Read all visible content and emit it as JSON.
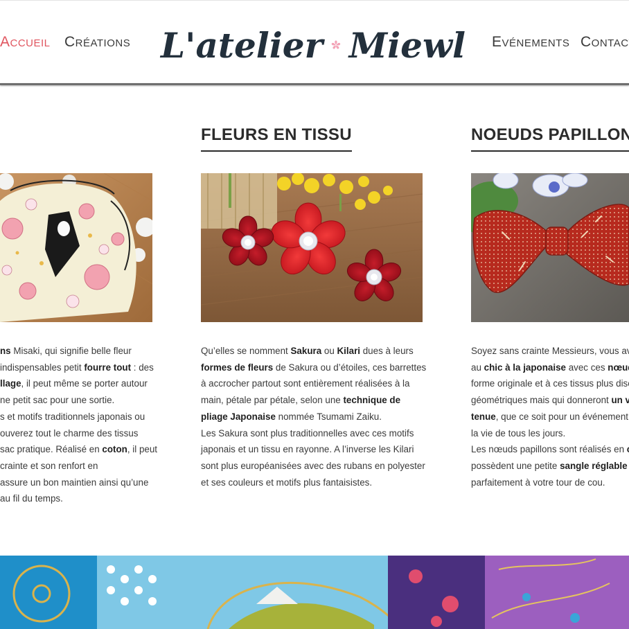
{
  "nav": {
    "left": [
      "Accueil",
      "Créations"
    ],
    "right": [
      "Evénements",
      "Contact"
    ],
    "active": "Accueil"
  },
  "logo": {
    "part1": "L'atelier",
    "part2": "Miewl",
    "flower_icon": "sakura-icon",
    "color": "#23303c",
    "flower_color": "#f08aa3"
  },
  "colors": {
    "accent": "#e0555f",
    "text": "#3a3a3a"
  },
  "columns": [
    {
      "title": "",
      "photo": "drawstring-bag-photo",
      "lines": [
        [
          {
            "t": "ns",
            "b": true
          },
          {
            "t": " Misaki, qui signifie belle fleur"
          }
        ],
        [
          {
            "t": "indispensables petit "
          },
          {
            "t": "fourre tout",
            "b": true
          },
          {
            "t": " : des"
          }
        ],
        [
          {
            "t": "llage",
            "b": true
          },
          {
            "t": ", il peut même se porter autour"
          }
        ],
        [
          {
            "t": "ne petit sac pour une sortie."
          }
        ],
        [
          {
            "t": "s et motifs traditionnels japonais ou"
          }
        ],
        [
          {
            "t": "ouverez tout le charme des tissus"
          }
        ],
        [
          {
            "t": " sac pratique. Réalisé en "
          },
          {
            "t": "coton",
            "b": true
          },
          {
            "t": ", il peut"
          }
        ],
        [
          {
            "t": "crainte et son renfort en"
          }
        ],
        [
          {
            "t": " assure un bon maintien ainsi qu’une"
          }
        ],
        [
          {
            "t": "au fil du temps."
          }
        ]
      ]
    },
    {
      "title": "Fleurs en tissu",
      "photo": "fabric-flowers-photo",
      "lines": [
        [
          {
            "t": "Qu’elles se nomment "
          },
          {
            "t": "Sakura",
            "b": true
          },
          {
            "t": " ou "
          },
          {
            "t": "Kilari",
            "b": true
          },
          {
            "t": " dues à leurs"
          }
        ],
        [
          {
            "t": "formes de fleurs",
            "b": true
          },
          {
            "t": " de Sakura ou d’étoiles, ces barrettes"
          }
        ],
        [
          {
            "t": "à accrocher partout sont entièrement réalisées à la"
          }
        ],
        [
          {
            "t": "main, pétale par pétale, selon une "
          },
          {
            "t": "technique de",
            "b": true
          }
        ],
        [
          {
            "t": "pliage Japonaise",
            "b": true
          },
          {
            "t": " nommée Tsumami Zaiku."
          }
        ],
        [
          {
            "t": "Les Sakura sont plus traditionnelles avec ces motifs"
          }
        ],
        [
          {
            "t": "japonais et un tissu en rayonne. A l’inverse les Kilari"
          }
        ],
        [
          {
            "t": "sont plus européanisées avec des rubans en polyester"
          }
        ],
        [
          {
            "t": "et ses couleurs et motifs plus fantaisistes."
          }
        ]
      ]
    },
    {
      "title": "Noeuds papillon",
      "photo": "bow-tie-photo",
      "lines": [
        [
          {
            "t": "Soyez sans crainte Messieurs, vous avez"
          }
        ],
        [
          {
            "t": "au "
          },
          {
            "t": "chic à la japonaise",
            "b": true
          },
          {
            "t": " avec ces "
          },
          {
            "t": "nœuds",
            "b": true
          }
        ],
        [
          {
            "t": "forme originale et à ces tissus plus discr"
          }
        ],
        [
          {
            "t": "géométriques mais qui donneront "
          },
          {
            "t": "un v",
            "b": true
          }
        ],
        [
          {
            "t": "tenue",
            "b": true
          },
          {
            "t": ", que ce soit pour un événement c"
          }
        ],
        [
          {
            "t": "la vie de tous les jours."
          }
        ],
        [
          {
            "t": "Les nœuds papillons sont réalisés en "
          },
          {
            "t": "co",
            "b": true
          }
        ],
        [
          {
            "t": "possèdent une petite "
          },
          {
            "t": "sangle réglable",
            "b": true
          },
          {
            "t": " p"
          }
        ],
        [
          {
            "t": "parfaitement à votre tour de cou."
          }
        ]
      ]
    }
  ],
  "banner": "japanese-fabric-banner"
}
